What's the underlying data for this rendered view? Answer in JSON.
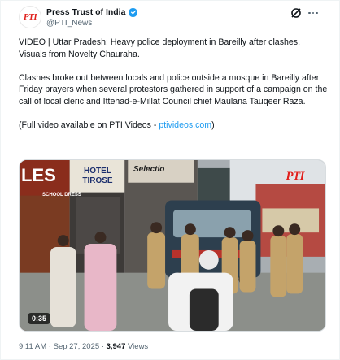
{
  "post": {
    "author": {
      "display_name": "Press Trust of India",
      "handle": "@PTI_News",
      "avatar_text": "PTI",
      "verified": true
    },
    "text": {
      "line1": "VIDEO | Uttar Pradesh: Heavy police deployment in Bareilly after clashes. Visuals from Novelty Chauraha.",
      "line2": "Clashes broke out between locals and police outside a mosque in Bareilly after Friday prayers when several protestors gathered in support of a campaign on the call of local cleric and Ittehad-e-Millat Council chief Maulana Tauqeer Raza.",
      "line3_prefix": "(Full video available on PTI Videos - ",
      "line3_link": "ptivideos.com",
      "line3_suffix": ")"
    },
    "media": {
      "watermark": "PTI",
      "duration": "0:35",
      "sign_left": "LES",
      "sign_hotel": "HOTEL TIROSE",
      "sign_school": "SCHOOL DRESS",
      "sign_right": "Selectio"
    },
    "meta": {
      "time": "9:11 AM",
      "separator": "·",
      "date": "Sep 27, 2025",
      "views_count": "3,947",
      "views_label": "Views"
    }
  },
  "icons": {
    "verified": "verified-badge-icon",
    "grok": "grok-icon",
    "more": "more-options-icon"
  },
  "colors": {
    "accent": "#1d9bf0",
    "text": "#0f1419",
    "muted": "#536471",
    "brand_red": "#e0201c"
  }
}
